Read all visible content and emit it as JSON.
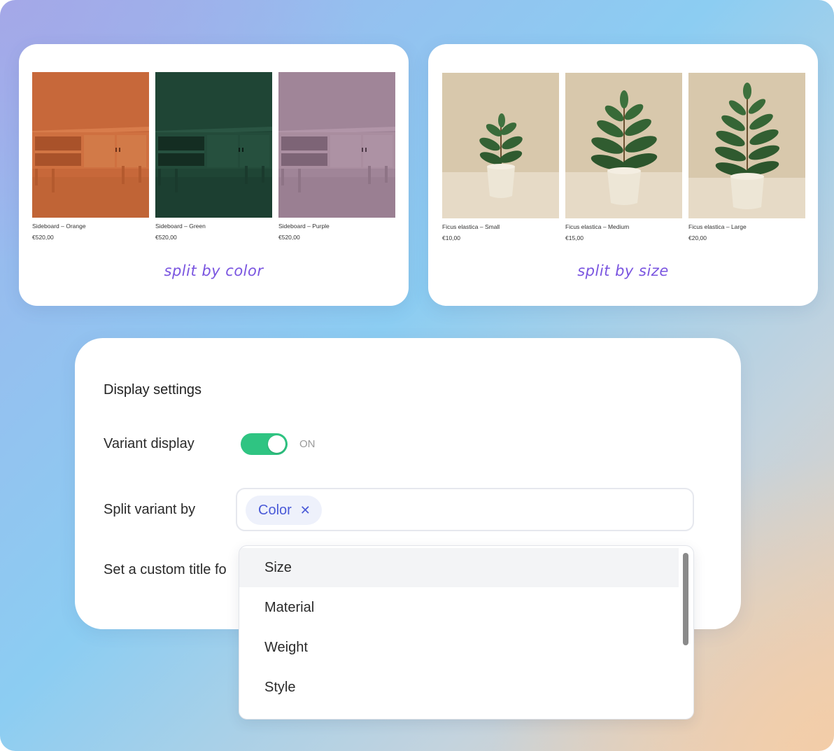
{
  "colors": {
    "accent_purple": "#7a55e0",
    "toggle_on": "#2fc482",
    "chip_text": "#4a5ad8",
    "chip_bg": "#eef1fb",
    "orange": "#c7683a",
    "green": "#1f4535",
    "purple": "#a08598"
  },
  "color_card": {
    "caption": "split by color",
    "products": [
      {
        "name": "Sideboard – Orange",
        "price": "€520,00"
      },
      {
        "name": "Sideboard – Green",
        "price": "€520,00"
      },
      {
        "name": "Sideboard – Purple",
        "price": "€520,00"
      }
    ]
  },
  "size_card": {
    "caption": "split by size",
    "products": [
      {
        "name": "Ficus elastica – Small",
        "price": "€10,00"
      },
      {
        "name": "Ficus elastica – Medium",
        "price": "€15,00"
      },
      {
        "name": "Ficus elastica – Large",
        "price": "€20,00"
      }
    ]
  },
  "settings": {
    "title": "Display settings",
    "variant_display_label": "Variant display",
    "variant_display_state": "ON",
    "split_label": "Split variant by",
    "selected_chip": "Color",
    "chip_remove_icon": "close-icon",
    "custom_title_label": "Set a custom title fo"
  },
  "dropdown": {
    "options": [
      "Size",
      "Material",
      "Weight",
      "Style"
    ]
  }
}
